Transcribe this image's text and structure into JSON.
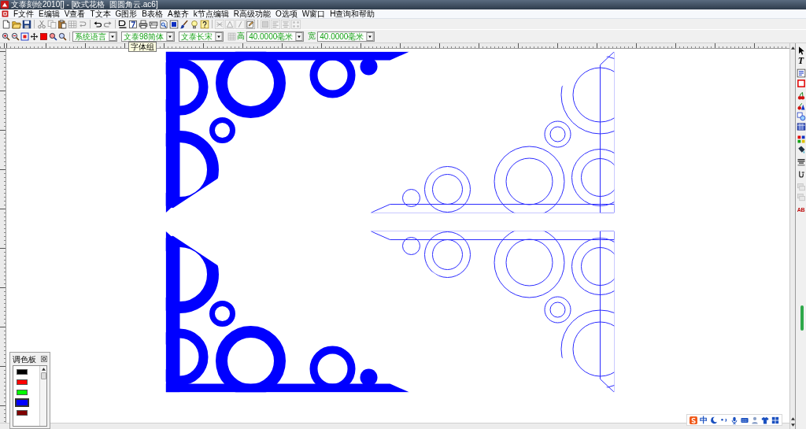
{
  "window": {
    "title": "文泰刻绘2010[] - [欧式花格  圆圆角云.ac6]"
  },
  "menu": [
    "F文件",
    "E编辑",
    "V查看",
    "T文本",
    "G图形",
    "B表格",
    "A整齐",
    "k节点编辑",
    "R高级功能",
    "O选项",
    "W窗口",
    "H查询和帮助"
  ],
  "toolbar_1": [
    {
      "disabled": false
    },
    {
      "disabled": false
    },
    {
      "disabled": false
    },
    {
      "disabled": true
    },
    {
      "disabled": true
    },
    {
      "disabled": false
    },
    {
      "disabled": true
    },
    {
      "disabled": true
    },
    {
      "disabled": false
    },
    {
      "disabled": true
    },
    {
      "disabled": false
    },
    {
      "disabled": false
    },
    {
      "disabled": false
    },
    {
      "disabled": false
    },
    {
      "disabled": false
    },
    {
      "disabled": false
    },
    {
      "disabled": false
    },
    {
      "disabled": false
    },
    {
      "disabled": false
    },
    {
      "disabled": true
    },
    {
      "disabled": true
    },
    {
      "disabled": true
    },
    {
      "disabled": false
    },
    {
      "disabled": true
    },
    {
      "disabled": true
    },
    {
      "disabled": true
    },
    {
      "disabled": true
    }
  ],
  "toolbar_2": {
    "buttons": [
      {
        "disabled": false
      },
      {
        "disabled": false
      },
      {
        "disabled": false
      },
      {
        "disabled": false
      },
      {
        "disabled": false
      },
      {
        "disabled": false
      },
      {
        "disabled": false
      }
    ],
    "language": "系统语言",
    "font_group": "文泰98简体",
    "font": "文泰长宋",
    "grid_button": {
      "disabled": true
    },
    "height_label": "高",
    "height": "40.0000毫米",
    "width_label": "宽",
    "width": "40.0000毫米"
  },
  "tooltip": "字体组",
  "canvas": {
    "ornaments": [
      {
        "kind": "filled"
      },
      {
        "kind": "outline"
      },
      {
        "kind": "filled"
      },
      {
        "kind": "outline"
      }
    ]
  },
  "right_toolbar": [
    {
      "disabled": false
    },
    {
      "label": "T",
      "disabled": false
    },
    {
      "disabled": false
    },
    {
      "disabled": false
    },
    {
      "disabled": false
    },
    {
      "disabled": false
    },
    {
      "disabled": false
    },
    {
      "disabled": false
    },
    {
      "disabled": false
    },
    {
      "disabled": false
    },
    {
      "disabled": false
    },
    {
      "disabled": false
    },
    {
      "disabled": true
    },
    {
      "disabled": true
    },
    {
      "label": "AB",
      "disabled": false
    }
  ],
  "palette": {
    "title": "调色板",
    "swatches": [
      {
        "color": "#000000",
        "selected": false
      },
      {
        "color": "#ff0000",
        "selected": false
      },
      {
        "color": "#00ff00",
        "selected": false
      },
      {
        "color": "#0000ff",
        "selected": true
      },
      {
        "color": "#800000",
        "selected": false
      }
    ]
  },
  "ime_bar": {
    "mode": "中"
  }
}
